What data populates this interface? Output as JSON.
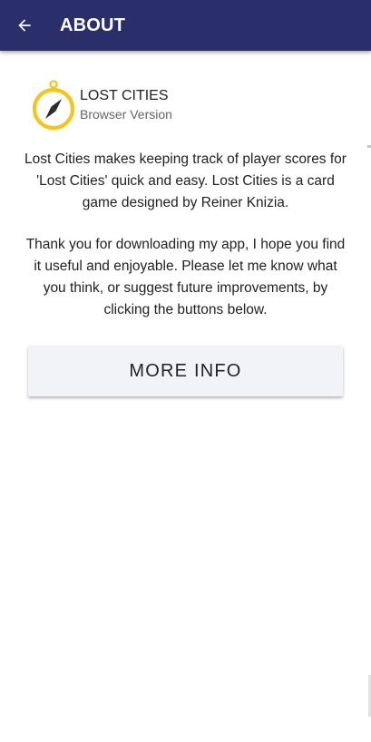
{
  "app_bar": {
    "title": "ABOUT",
    "back_icon": "arrow-left-icon",
    "background": "#2a2f6b"
  },
  "app_info": {
    "name": "LOST CITIES",
    "version": "Browser Version",
    "logo_icon": "compass-icon",
    "logo_color": "#f5c518"
  },
  "about": {
    "paragraph_1": "Lost Cities makes keeping track of player scores for 'Lost Cities' quick and easy. Lost Cities is a card game designed by Reiner Knizia.",
    "paragraph_2": "Thank you for downloading my app, I hope you find it useful and enjoyable. Please let me know what you think, or suggest future improvements, by clicking the buttons below."
  },
  "buttons": {
    "more_info_label": "MORE INFO"
  }
}
